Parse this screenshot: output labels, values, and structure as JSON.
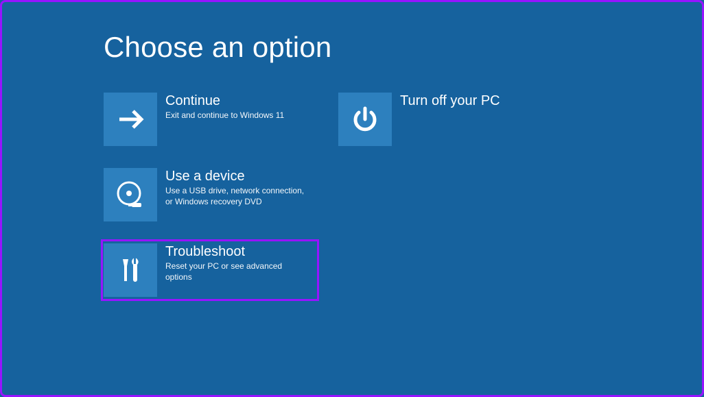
{
  "title": "Choose an option",
  "options": {
    "continue": {
      "title": "Continue",
      "desc": "Exit and continue to Windows 11"
    },
    "use_device": {
      "title": "Use a device",
      "desc": "Use a USB drive, network connection, or Windows recovery DVD"
    },
    "troubleshoot": {
      "title": "Troubleshoot",
      "desc": "Reset your PC or see advanced options"
    },
    "turn_off": {
      "title": "Turn off your PC",
      "desc": ""
    }
  }
}
